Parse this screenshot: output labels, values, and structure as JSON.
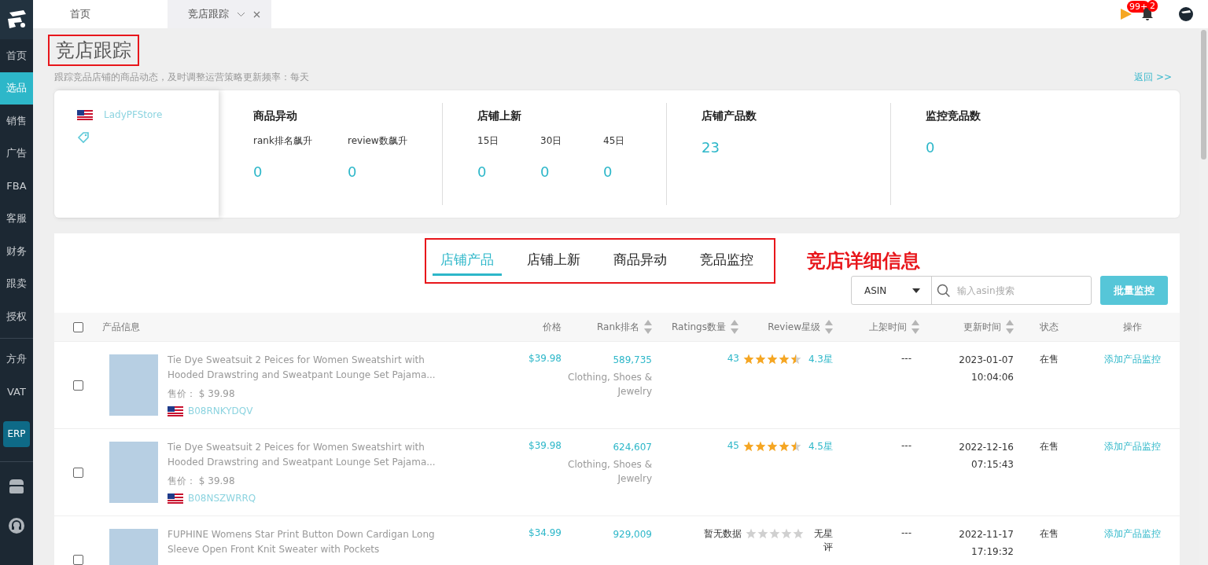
{
  "sidebar": {
    "items": [
      {
        "label": "首页",
        "selected": false
      },
      {
        "label": "选品",
        "selected": true
      },
      {
        "label": "销售",
        "selected": false
      },
      {
        "label": "广告",
        "selected": false
      },
      {
        "label": "FBA",
        "selected": false
      },
      {
        "label": "客服",
        "selected": false
      },
      {
        "label": "财务",
        "selected": false
      },
      {
        "label": "跟卖",
        "selected": false
      },
      {
        "label": "授权",
        "selected": false
      }
    ],
    "extra_items": [
      {
        "label": "方舟"
      },
      {
        "label": "VAT"
      }
    ],
    "erp_button": "ERP"
  },
  "top_tabs": [
    {
      "label": "首页",
      "selected": false,
      "closable": false
    },
    {
      "label": "竞店跟踪",
      "selected": true,
      "closable": true
    }
  ],
  "header": {
    "flag_badge": "99+",
    "bell_badge": "2"
  },
  "page": {
    "title": "竞店跟踪",
    "subtitle": "跟踪竞品店铺的商品动态，及时调整运营策略更新频率：每天",
    "back_link": "返回 >>"
  },
  "store": {
    "name": "LadyPFStore"
  },
  "stats": [
    {
      "title": "商品异动",
      "items": [
        {
          "label": "rank排名飙升",
          "value": "0"
        },
        {
          "label": "review数飙升",
          "value": "0"
        }
      ]
    },
    {
      "title": "店铺上新",
      "items": [
        {
          "label": "15日",
          "value": "0"
        },
        {
          "label": "30日",
          "value": "0"
        },
        {
          "label": "45日",
          "value": "0"
        }
      ]
    },
    {
      "title": "店铺产品数",
      "items": [
        {
          "value": "23"
        }
      ]
    },
    {
      "title": "监控竞品数",
      "items": [
        {
          "value": "0"
        }
      ]
    }
  ],
  "section_tabs": [
    {
      "label": "店铺产品",
      "selected": true
    },
    {
      "label": "店铺上新",
      "selected": false
    },
    {
      "label": "商品异动",
      "selected": false
    },
    {
      "label": "竞品监控",
      "selected": false
    }
  ],
  "annotation": "竞店详细信息",
  "search": {
    "type": "ASIN",
    "placeholder": "输入asin搜索",
    "button": "批量监控"
  },
  "table": {
    "select_all": {
      "checked": false
    },
    "columns": [
      {
        "label": "产品信息",
        "sortable": false
      },
      {
        "label": "价格",
        "sortable": false
      },
      {
        "label": "Rank排名",
        "sortable": true
      },
      {
        "label": "Ratings数量",
        "sortable": true
      },
      {
        "label": "Review星级",
        "sortable": true
      },
      {
        "label": "上架时间",
        "sortable": true
      },
      {
        "label": "更新时间",
        "sortable": true
      },
      {
        "label": "状态",
        "sortable": false
      },
      {
        "label": "操作",
        "sortable": false
      }
    ],
    "rows": [
      {
        "checked": false,
        "title": "Tie Dye Sweatsuit 2 Peices for Women Sweatshirt with Hooded Drawstring and Sweatpant Lounge Set Pajama...",
        "sale_price": "售价： $ 39.98",
        "asin": "B08RNKYDQV",
        "price": "$39.98",
        "rank": "589,735",
        "category": "Clothing, Shoes & Jewelry",
        "ratings": "43",
        "stars": 4.5,
        "review": "4.3星",
        "listed": "---",
        "updated_date": "2023-01-07",
        "updated_time": "10:04:06",
        "status": "在售",
        "action": "添加产品监控"
      },
      {
        "checked": false,
        "title": "Tie Dye Sweatsuit 2 Peices for Women Sweatshirt with Hooded Drawstring and Sweatpant Lounge Set Pajama...",
        "sale_price": "售价： $ 39.98",
        "asin": "B08NSZWRRQ",
        "price": "$39.98",
        "rank": "624,607",
        "category": "Clothing, Shoes & Jewelry",
        "ratings": "45",
        "stars": 4.5,
        "review": "4.5星",
        "listed": "---",
        "updated_date": "2022-12-16",
        "updated_time": "07:15:43",
        "status": "在售",
        "action": "添加产品监控"
      },
      {
        "checked": false,
        "title": "FUPHINE Womens Star Print Button Down Cardigan Long Sleeve Open Front Knit Sweater with Pockets",
        "price": "$34.99",
        "rank": "929,009",
        "ratings": "暂无数据",
        "stars": 0,
        "review": "无星评",
        "listed": "---",
        "updated_date": "2022-11-17",
        "updated_time": "17:19:32",
        "status": "在售",
        "action": "添加产品监控"
      }
    ]
  }
}
